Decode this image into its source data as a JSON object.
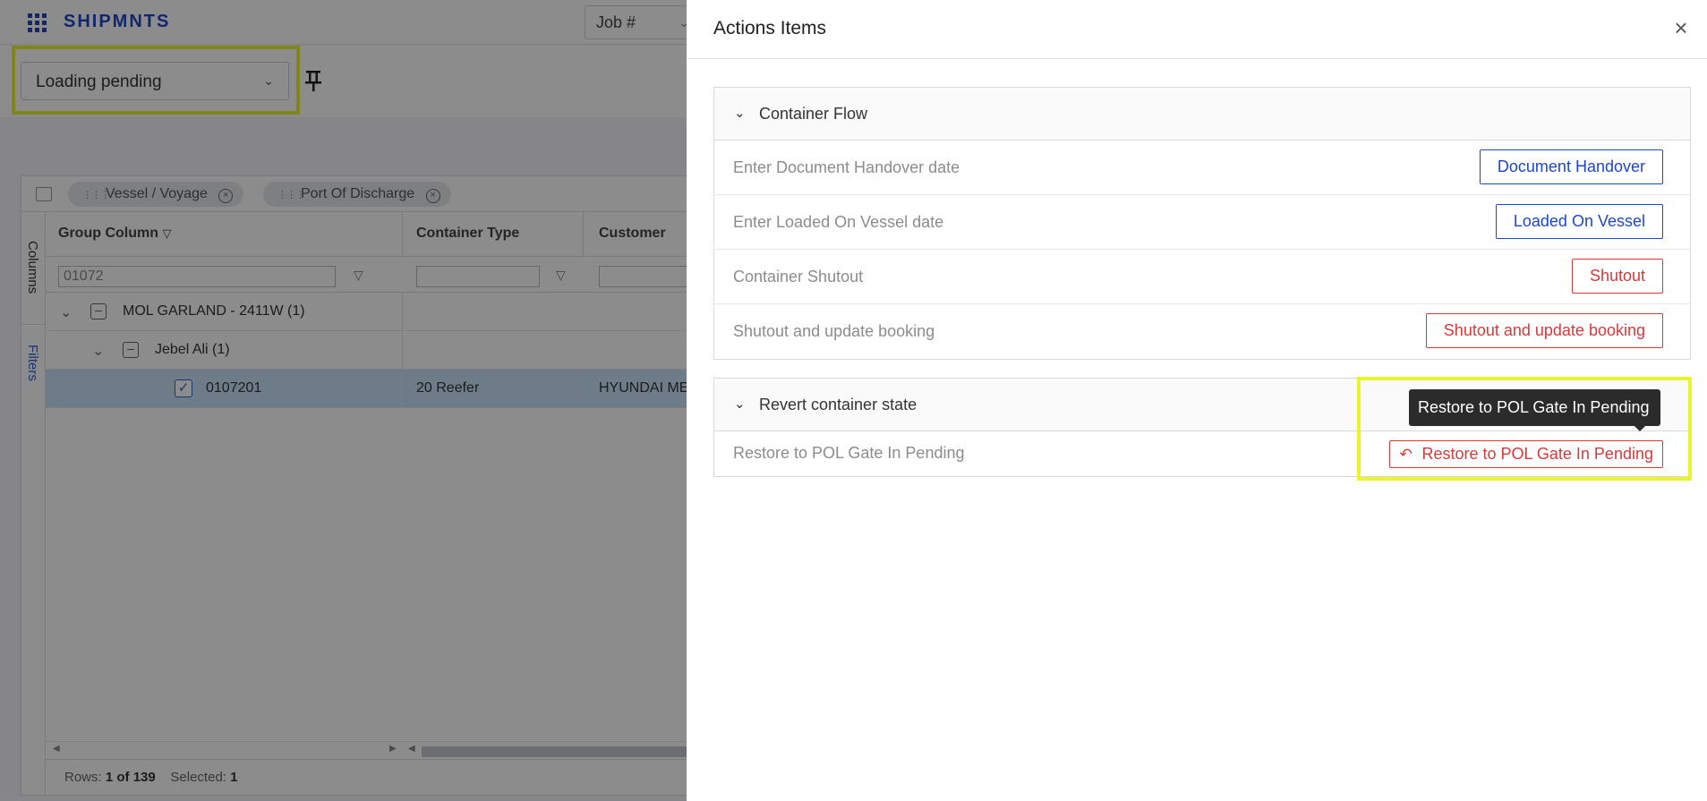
{
  "app": {
    "brand": "SHIPMNTS",
    "job_select_label": "Job #",
    "view_select": "Loading pending"
  },
  "grid": {
    "group_chips": [
      "Vessel / Voyage",
      "Port Of Discharge"
    ],
    "side_tabs": {
      "columns": "Columns",
      "filters": "Filters"
    },
    "columns": [
      "Group Column",
      "Container Type",
      "Customer"
    ],
    "filter_value": "01072",
    "rows": [
      {
        "group": "MOL GARLAND - 2411W (1)"
      },
      {
        "group": "Jebel Ali (1)"
      },
      {
        "container": "0107201",
        "type": "20 Reefer",
        "customer": "HYUNDAI MERCH"
      }
    ],
    "status": {
      "rows_label": "Rows:",
      "rows_value": "1 of 139",
      "selected_label": "Selected:",
      "selected_value": "1"
    }
  },
  "drawer": {
    "title": "Actions Items",
    "close_icon": "close-icon",
    "panels": [
      {
        "title": "Container Flow",
        "rows": [
          {
            "label": "Enter Document Handover date",
            "button": "Document Handover",
            "color": "#1f46c7"
          },
          {
            "label": "Enter Loaded On Vessel date",
            "button": "Loaded On Vessel",
            "color": "#1f46c7"
          },
          {
            "label": "Container Shutout",
            "button": "Shutout",
            "color": "#d53a3a"
          },
          {
            "label": "Shutout and update booking",
            "button": "Shutout and update booking",
            "color": "#d53a3a"
          }
        ]
      },
      {
        "title": "Revert container state",
        "rows": [
          {
            "label": "Restore to POL Gate In Pending",
            "button": "Restore to POL Gate In Pending",
            "color": "#d53a3a",
            "icon": "undo-icon"
          }
        ]
      }
    ],
    "tooltip": "Restore to POL Gate In Pending"
  },
  "colors": {
    "brand": "#1f46c7",
    "danger": "#d53a3a",
    "highlight": "#e8f52a",
    "selected_row": "#c8e0f7"
  }
}
